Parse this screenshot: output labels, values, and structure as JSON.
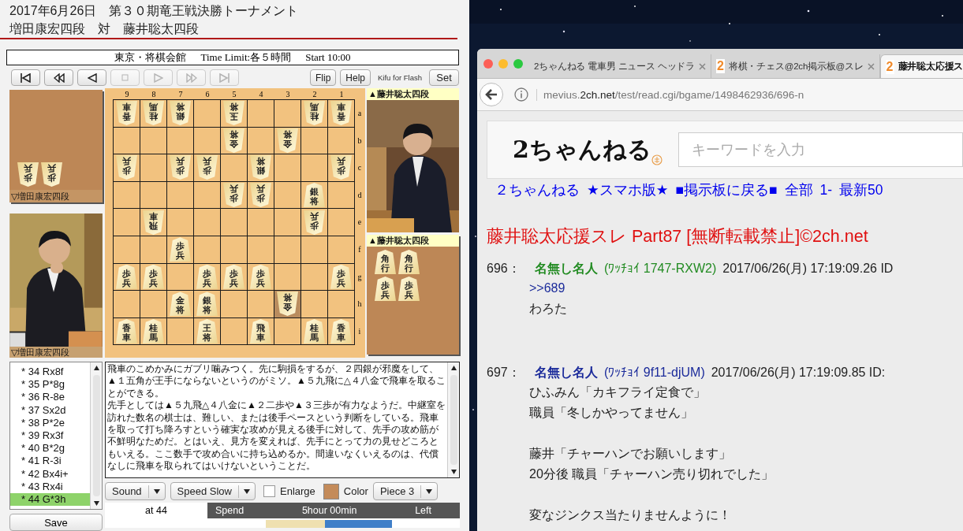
{
  "header": {
    "title": "2017年6月26日　第３０期竜王戦決勝トーナメント",
    "players": "増田康宏四段　対　藤井聡太四段"
  },
  "info": {
    "venue": "東京・将棋会館",
    "time_limit": "Time Limit:各５時間",
    "start": "Start 10:00"
  },
  "toolbar": {
    "nav_buttons": [
      {
        "kind": "first",
        "disabled": false
      },
      {
        "kind": "back",
        "disabled": false
      },
      {
        "kind": "prev",
        "disabled": false
      },
      {
        "kind": "stop",
        "disabled": true
      },
      {
        "kind": "next",
        "disabled": true
      },
      {
        "kind": "forward",
        "disabled": true
      },
      {
        "kind": "last",
        "disabled": true
      }
    ],
    "buttons": [
      "Flip",
      "Help"
    ],
    "brand": "Kifu for Flash",
    "set": "Set"
  },
  "gote": {
    "hand_label": "▽増田康宏四段",
    "hand": [
      [
        "歩兵",
        "歩兵"
      ]
    ],
    "photo_label": "▽増田康宏四段"
  },
  "sente": {
    "photo_label": "▲藤井聡太四段",
    "hand_label": "▲藤井聡太四段",
    "hand": [
      [
        "角行",
        "角行"
      ],
      [
        "歩兵",
        "歩兵"
      ]
    ]
  },
  "board": {
    "files": [
      "9",
      "8",
      "7",
      "6",
      "5",
      "4",
      "3",
      "2",
      "1"
    ],
    "ranks": [
      "a",
      "b",
      "c",
      "d",
      "e",
      "f",
      "g",
      "h",
      "i"
    ],
    "rows": [
      [
        {
          "piece": "香車",
          "kind": "gote",
          "highlighted": false
        },
        {
          "piece": "桂馬",
          "kind": "gote",
          "highlighted": false
        },
        {
          "piece": "銀将",
          "kind": "gote",
          "highlighted": false
        },
        null,
        {
          "piece": "玉将",
          "kind": "gote",
          "highlighted": false
        },
        null,
        null,
        {
          "piece": "桂馬",
          "kind": "gote",
          "highlighted": false
        },
        {
          "piece": "香車",
          "kind": "gote",
          "highlighted": false
        }
      ],
      [
        null,
        null,
        null,
        null,
        {
          "piece": "金将",
          "kind": "gote",
          "highlighted": false
        },
        null,
        {
          "piece": "金将",
          "kind": "gote",
          "highlighted": false
        },
        null,
        null
      ],
      [
        {
          "piece": "歩兵",
          "kind": "gote",
          "highlighted": false
        },
        null,
        {
          "piece": "歩兵",
          "kind": "gote",
          "highlighted": false
        },
        {
          "piece": "歩兵",
          "kind": "gote",
          "highlighted": false
        },
        null,
        {
          "piece": "銀将",
          "kind": "gote",
          "highlighted": false
        },
        null,
        null,
        {
          "piece": "歩兵",
          "kind": "gote",
          "highlighted": false
        }
      ],
      [
        null,
        null,
        null,
        null,
        {
          "piece": "歩兵",
          "kind": "gote",
          "highlighted": false
        },
        {
          "piece": "歩兵",
          "kind": "gote",
          "highlighted": false
        },
        null,
        {
          "piece": "銀将",
          "kind": "sente",
          "highlighted": false
        },
        null
      ],
      [
        null,
        {
          "piece": "飛車",
          "kind": "gote",
          "highlighted": false
        },
        null,
        null,
        null,
        null,
        null,
        {
          "piece": "歩兵",
          "kind": "gote",
          "highlighted": false
        },
        null
      ],
      [
        null,
        null,
        {
          "piece": "歩兵",
          "kind": "sente",
          "highlighted": false
        },
        null,
        null,
        null,
        null,
        null,
        null
      ],
      [
        {
          "piece": "歩兵",
          "kind": "sente",
          "highlighted": false
        },
        {
          "piece": "歩兵",
          "kind": "sente",
          "highlighted": false
        },
        null,
        {
          "piece": "歩兵",
          "kind": "sente",
          "highlighted": false
        },
        {
          "piece": "歩兵",
          "kind": "sente",
          "highlighted": false
        },
        {
          "piece": "歩兵",
          "kind": "sente",
          "highlighted": false
        },
        null,
        null,
        {
          "piece": "歩兵",
          "kind": "sente",
          "highlighted": false
        }
      ],
      [
        null,
        null,
        {
          "piece": "金将",
          "kind": "sente",
          "highlighted": false
        },
        {
          "piece": "銀将",
          "kind": "sente",
          "highlighted": false
        },
        null,
        null,
        {
          "piece": "金将",
          "kind": "gote",
          "highlighted": true
        },
        null,
        null
      ],
      [
        {
          "piece": "香車",
          "kind": "sente",
          "highlighted": false
        },
        {
          "piece": "桂馬",
          "kind": "sente",
          "highlighted": false
        },
        null,
        {
          "piece": "王将",
          "kind": "sente",
          "highlighted": false
        },
        null,
        {
          "piece": "飛車",
          "kind": "sente",
          "highlighted": false
        },
        null,
        {
          "piece": "桂馬",
          "kind": "sente",
          "highlighted": false
        },
        {
          "piece": "香車",
          "kind": "sente",
          "highlighted": false
        }
      ]
    ]
  },
  "moves": [
    {
      "text": "* 34 Rx8f",
      "selected": false
    },
    {
      "text": "* 35 P*8g",
      "selected": false
    },
    {
      "text": "* 36 R-8e",
      "selected": false
    },
    {
      "text": "* 37 Sx2d",
      "selected": false
    },
    {
      "text": "* 38 P*2e",
      "selected": false
    },
    {
      "text": "* 39 Rx3f",
      "selected": false
    },
    {
      "text": "* 40 B*2g",
      "selected": false
    },
    {
      "text": "* 41 R-3i",
      "selected": false
    },
    {
      "text": "* 42 Bx4i+",
      "selected": false
    },
    {
      "text": "* 43 Rx4i",
      "selected": false
    },
    {
      "text": "* 44 G*3h",
      "selected": true
    }
  ],
  "save": "Save",
  "comment": [
    "飛車のこめかみにガブリ噛みつく。先に駒損をするが、２四銀が邪魔をして、▲１五角が王手にならないというのがミソ。▲５九飛に△４八金で飛車を取ることができる。",
    "先手としては▲５九飛△４八金に▲２二歩や▲３三歩が有力なようだ。中継室を訪れた数名の棋士は、難しい、または後手ペースという判断をしている。飛車を取って打ち降ろすという確実な攻めが見える後手に対して、先手の攻め筋が不鮮明なためだ。とはいえ、見方を変えれば、先手にとって力の見せどころともいえる。ここ数手で攻め合いに持ち込めるか。間違いなくいえるのは、代償なしに飛車を取られてはいけないということだ。"
  ],
  "controls": {
    "sound": "Sound",
    "speed": "Speed Slow",
    "enlarge": {
      "label": "Enlarge",
      "checked": false
    },
    "color_label": "Color",
    "piece": "Piece 3"
  },
  "time_table": {
    "move": "at 44",
    "spend": "Spend",
    "limit": "5hour 00min",
    "left": "Left",
    "spend_bar": {
      "level": 0.47
    }
  },
  "browser": {
    "tabs": [
      {
        "title": "2ちゃんねる 電車男 ニュース ヘッドラ",
        "selected": false
      },
      {
        "title": "将棋・チェス@2ch掲示板@スレ",
        "badge": "2",
        "selected": false
      },
      {
        "title": "藤井聡太応援ス",
        "badge": "2",
        "selected": true
      }
    ],
    "url": {
      "prefix": "mevius.",
      "domain": "2ch.net",
      "path": "/test/read.cgi/bgame/1498462936/696-n"
    },
    "logo": "2ちゃんねる",
    "search_placeholder": "キーワードを入力",
    "nav_links": [
      "２ちゃんねる",
      "★スマホ版★",
      "■掲示板に戻る■",
      "全部",
      "1-",
      "最新50"
    ],
    "thread_title": "藤井聡太応援スレ Part87 [無断転載禁止]©2ch.net",
    "posts": [
      {
        "number": "696：",
        "name": "名無し名人",
        "trip": "(ﾜｯﾁｮｲ 1747-RXW2)",
        "color": "#228b22",
        "date": "2017/06/26(月) 17:19:09.26 ID",
        "body": [
          {
            "kind": "link",
            "text": ">>689"
          },
          {
            "kind": "text",
            "text": "わろた"
          }
        ]
      },
      {
        "number": "697：",
        "name": "名無し名人",
        "trip": "(ﾜｯﾁｮｲ 9f11-djUM)",
        "color": "#1a2a9a",
        "date": "2017/06/26(月) 17:19:09.85 ID:",
        "body": [
          {
            "kind": "text",
            "text": "ひふみん「カキフライ定食で」"
          },
          {
            "kind": "text",
            "text": "職員「冬しかやってません」"
          },
          {
            "kind": "gap"
          },
          {
            "kind": "text",
            "text": "藤井「チャーハンでお願いします」"
          },
          {
            "kind": "text",
            "text": "20分後 職員「チャーハン売り切れでした」"
          },
          {
            "kind": "gap"
          },
          {
            "kind": "text",
            "text": "変なジンクス当たりませんように！"
          }
        ]
      }
    ]
  }
}
